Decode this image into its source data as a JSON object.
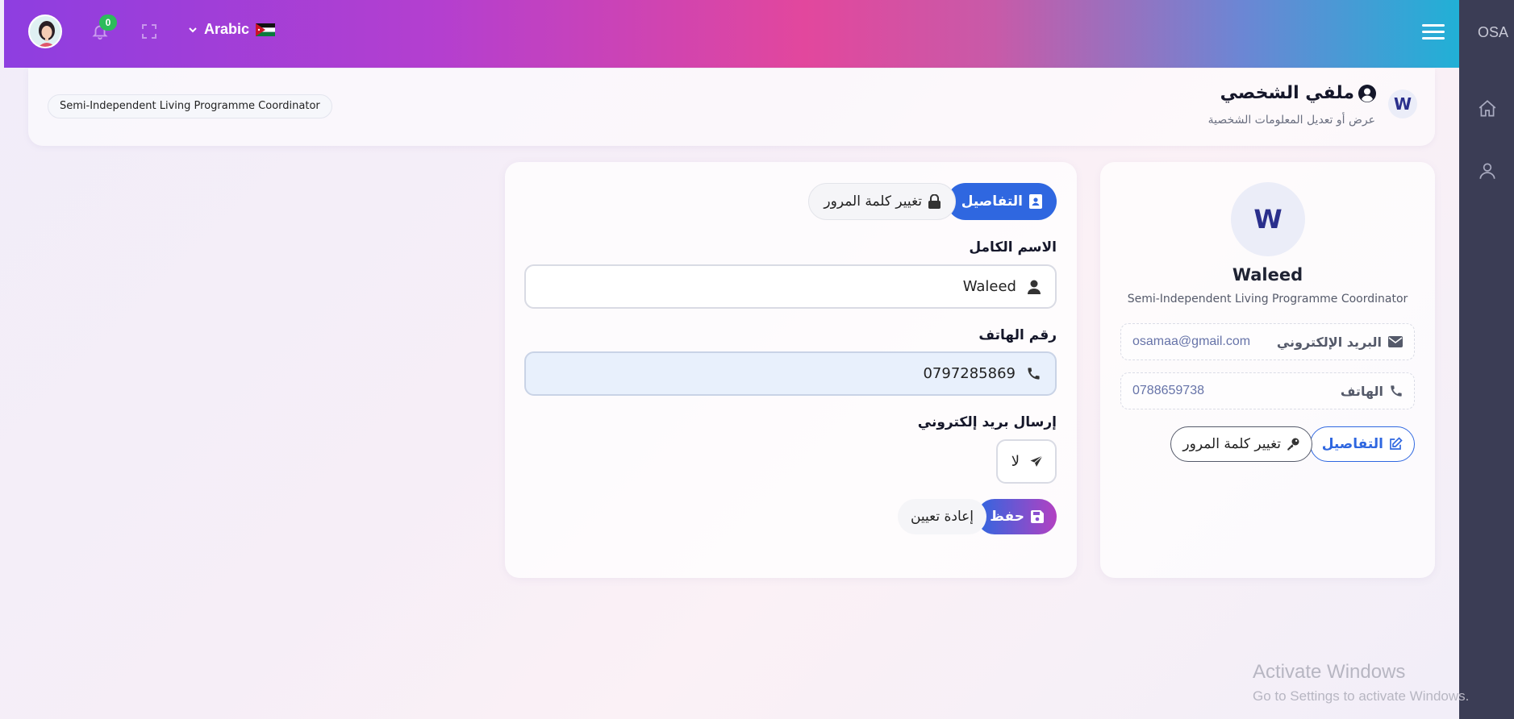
{
  "topbar": {
    "notification_count": "0",
    "language": "Arabic"
  },
  "sidebar": {
    "brand": "OSA"
  },
  "header": {
    "role_chip": "Semi-Independent Living Programme Coordinator",
    "title": "ملفي الشخصي",
    "subtitle": "عرض أو تعديل المعلومات الشخصية",
    "avatar_letter": "W"
  },
  "form": {
    "tabs": [
      {
        "label": "التفاصيل",
        "icon": "id-card-icon",
        "active": true
      },
      {
        "label": "تغيير كلمة المرور",
        "icon": "lock-icon",
        "active": false
      }
    ],
    "full_name_label": "الاسم الكامل",
    "full_name_value": "Waleed",
    "phone_label": "رقم الهاتف",
    "phone_value": "0797285869",
    "send_email_label": "إرسال بريد إلكتروني",
    "send_email_value": "لا",
    "save_label": "حفظ",
    "reset_label": "إعادة تعيين"
  },
  "profile": {
    "avatar_letter": "W",
    "name": "Waleed",
    "role": "Semi-Independent Living Programme Coordinator",
    "email_key": "البريد الإلكتروني",
    "email_value": "osamaa@gmail.com",
    "phone_key": "الهاتف",
    "phone_value": "0788659738",
    "edit_label": "التفاصيل",
    "password_label": "تغيير كلمة المرور"
  },
  "watermark": {
    "title": "Activate Windows",
    "subtitle": "Go to Settings to activate Windows."
  },
  "colors": {
    "primary": "#2f67e0",
    "sidebar": "#3b3d55",
    "badge": "#2dbb5b"
  }
}
